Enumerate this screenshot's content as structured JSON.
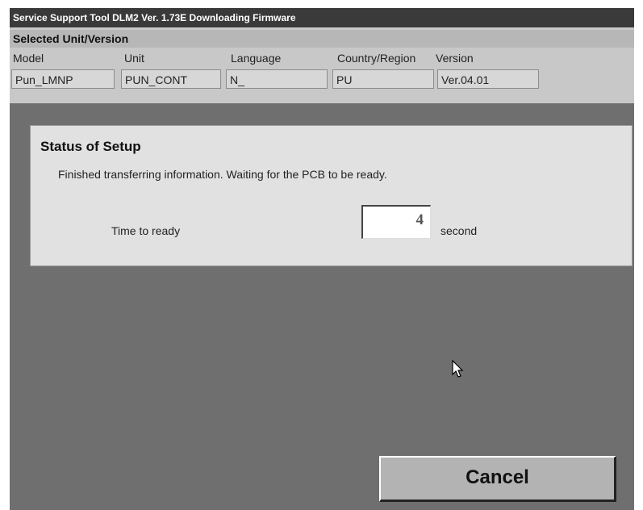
{
  "window": {
    "title": "Service Support Tool DLM2 Ver. 1.73E  Downloading Firmware"
  },
  "selected": {
    "header": "Selected Unit/Version",
    "columns": [
      "Model",
      "Unit",
      "Language",
      "Country/Region",
      "Version"
    ],
    "values": [
      "Pun_LMNP",
      "PUN_CONT",
      "N_",
      "PU",
      "Ver.04.01"
    ]
  },
  "status": {
    "title": "Status of Setup",
    "message": "Finished transferring information. Waiting for the PCB to be ready.",
    "time_label": "Time to ready",
    "time_value": "4",
    "time_unit": "second"
  },
  "buttons": {
    "cancel": "Cancel"
  },
  "cursor_icon": "mouse-pointer-icon"
}
